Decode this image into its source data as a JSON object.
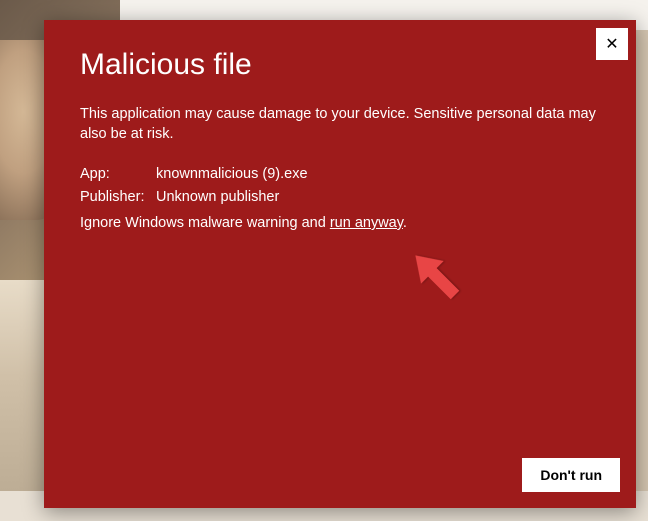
{
  "dialog": {
    "title": "Malicious file",
    "description": "This application may cause damage to your device. Sensitive personal data may also be at risk.",
    "app_label": "App:",
    "app_value": "knownmalicious (9).exe",
    "publisher_label": "Publisher:",
    "publisher_value": "Unknown publisher",
    "ignore_prefix": "Ignore Windows malware warning and ",
    "run_anyway_link": "run anyway",
    "ignore_suffix": ".",
    "dont_run_button": "Don't run",
    "close_symbol": "✕"
  }
}
